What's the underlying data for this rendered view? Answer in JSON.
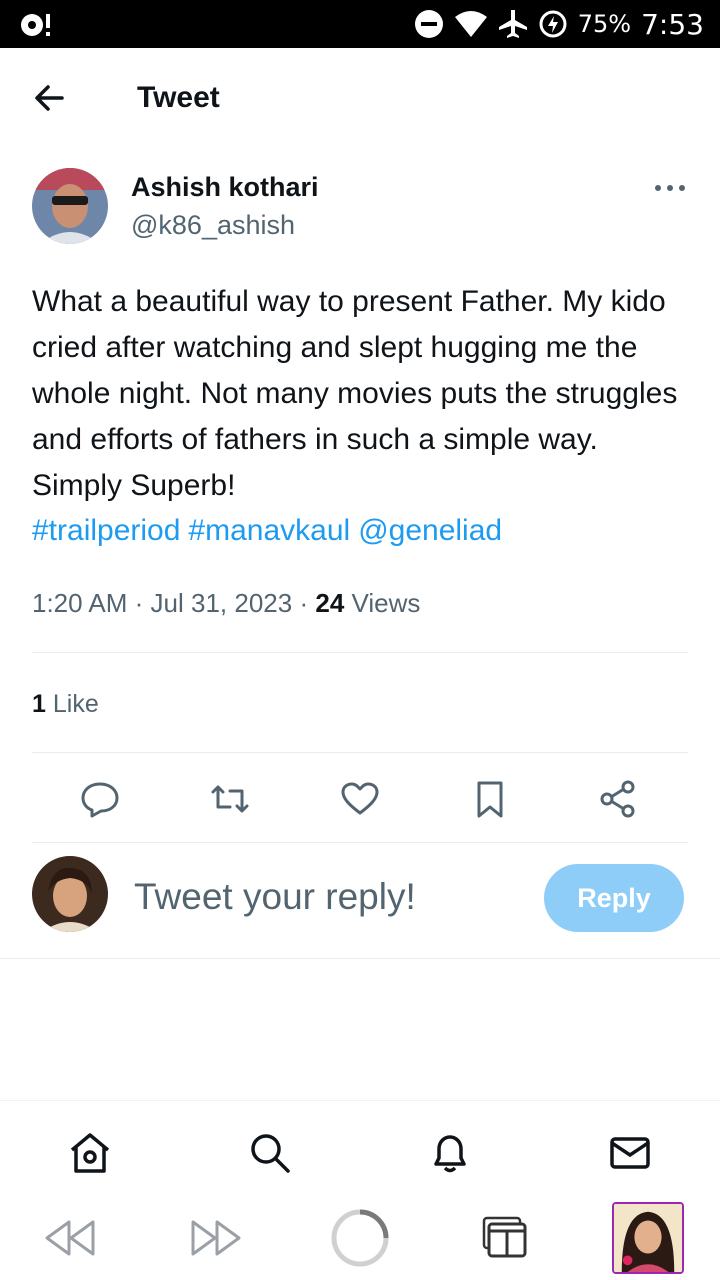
{
  "status_bar": {
    "battery": "75%",
    "time": "7:53",
    "icons": [
      "media-icon",
      "dnd-icon",
      "wifi-icon",
      "airplane-icon",
      "battery-saver-icon"
    ]
  },
  "header": {
    "title": "Tweet"
  },
  "tweet": {
    "author_name": "Ashish kothari",
    "author_handle": "@k86_ashish",
    "text": "What a beautiful way to present Father. My kido cried after watching and slept hugging me the whole night. Not many movies puts the struggles and efforts of fathers in such a simple way. Simply Superb!",
    "tags": [
      "#trailperiod",
      "#manavkaul",
      "@geneliad"
    ],
    "time": "1:20 AM",
    "date": "Jul 31, 2023",
    "separator": "·",
    "views_count": "24",
    "views_label": "Views",
    "likes_count": "1",
    "likes_label": "Like"
  },
  "reply": {
    "placeholder": "Tweet your reply!",
    "button_label": "Reply"
  },
  "colors": {
    "accent": "#1d9bf0",
    "reply_button": "#8ecdf8",
    "secondary_text": "#536471"
  }
}
